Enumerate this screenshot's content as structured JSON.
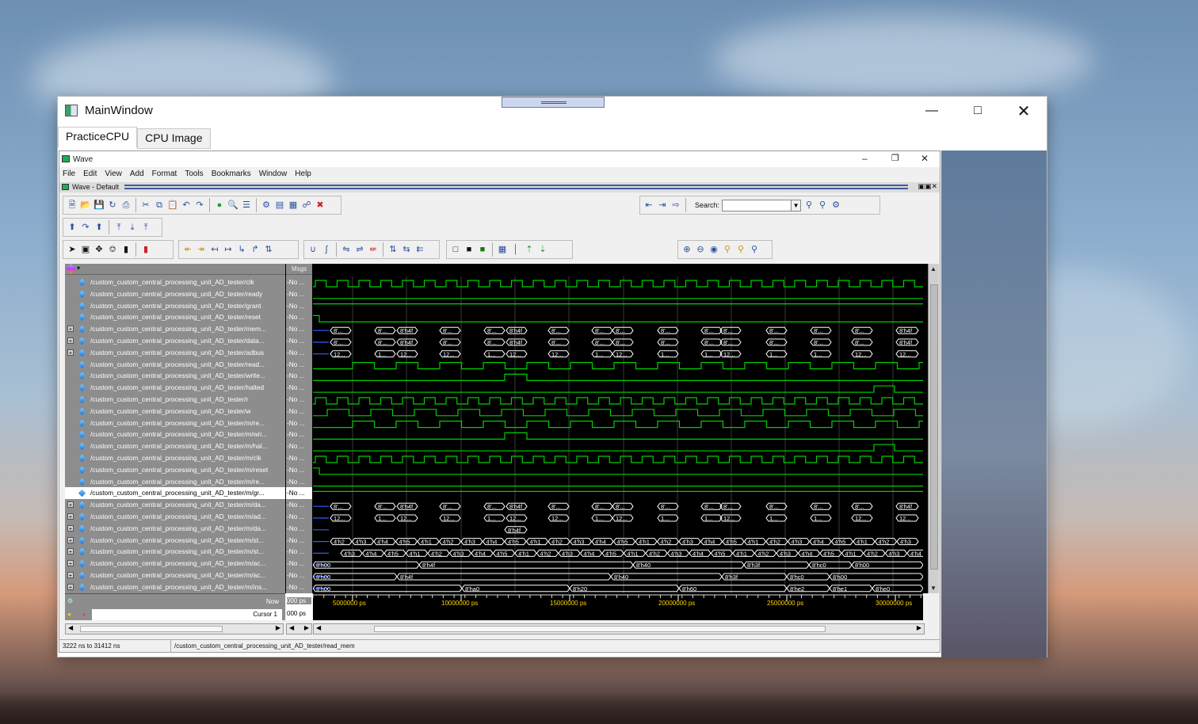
{
  "main_window": {
    "title": "MainWindow",
    "tabs": [
      "PracticeCPU",
      "CPU Image"
    ],
    "active_tab": 0
  },
  "wave_window": {
    "title": "Wave",
    "menu": [
      "File",
      "Edit",
      "View",
      "Add",
      "Format",
      "Tools",
      "Bookmarks",
      "Window",
      "Help"
    ],
    "doc_title": "Wave - Default",
    "search_label": "Search:",
    "msgs_header": "Msgs",
    "signals": [
      {
        "name": "/custom_custom_central_processing_unit_AD_tester/clk",
        "msg": "-No ...",
        "expandable": false
      },
      {
        "name": "/custom_custom_central_processing_unit_AD_tester/ready",
        "msg": "-No ...",
        "expandable": false
      },
      {
        "name": "/custom_custom_central_processing_unit_AD_tester/grant",
        "msg": "-No ...",
        "expandable": false
      },
      {
        "name": "/custom_custom_central_processing_unit_AD_tester/reset",
        "msg": "-No ...",
        "expandable": false
      },
      {
        "name": "/custom_custom_central_processing_unit_AD_tester/mem...",
        "msg": "-No ...",
        "expandable": true
      },
      {
        "name": "/custom_custom_central_processing_unit_AD_tester/data...",
        "msg": "-No ...",
        "expandable": true
      },
      {
        "name": "/custom_custom_central_processing_unit_AD_tester/adbus",
        "msg": "-No ...",
        "expandable": true
      },
      {
        "name": "/custom_custom_central_processing_unit_AD_tester/read...",
        "msg": "-No ...",
        "expandable": false
      },
      {
        "name": "/custom_custom_central_processing_unit_AD_tester/write...",
        "msg": "-No ...",
        "expandable": false
      },
      {
        "name": "/custom_custom_central_processing_unit_AD_tester/halted",
        "msg": "-No ...",
        "expandable": false
      },
      {
        "name": "/custom_custom_central_processing_unit_AD_tester/r",
        "msg": "-No ...",
        "expandable": false
      },
      {
        "name": "/custom_custom_central_processing_unit_AD_tester/w",
        "msg": "-No ...",
        "expandable": false
      },
      {
        "name": "/custom_custom_central_processing_unit_AD_tester/m/re...",
        "msg": "-No ...",
        "expandable": false
      },
      {
        "name": "/custom_custom_central_processing_unit_AD_tester/m/wri...",
        "msg": "-No ...",
        "expandable": false
      },
      {
        "name": "/custom_custom_central_processing_unit_AD_tester/m/hal...",
        "msg": "-No ...",
        "expandable": false
      },
      {
        "name": "/custom_custom_central_processing_unit_AD_tester/m/clk",
        "msg": "-No ...",
        "expandable": false
      },
      {
        "name": "/custom_custom_central_processing_unit_AD_tester/m/reset",
        "msg": "-No ...",
        "expandable": false
      },
      {
        "name": "/custom_custom_central_processing_unit_AD_tester/m/re...",
        "msg": "-No ...",
        "expandable": false
      },
      {
        "name": "/custom_custom_central_processing_unit_AD_tester/m/gr...",
        "msg": "-No ...",
        "expandable": false,
        "selected": true
      },
      {
        "name": "/custom_custom_central_processing_unit_AD_tester/m/da...",
        "msg": "-No ...",
        "expandable": true
      },
      {
        "name": "/custom_custom_central_processing_unit_AD_tester/m/ad...",
        "msg": "-No ...",
        "expandable": true
      },
      {
        "name": "/custom_custom_central_processing_unit_AD_tester/m/da...",
        "msg": "-No ...",
        "expandable": true
      },
      {
        "name": "/custom_custom_central_processing_unit_AD_tester/m/st...",
        "msg": "-No ...",
        "expandable": true
      },
      {
        "name": "/custom_custom_central_processing_unit_AD_tester/m/st...",
        "msg": "-No ...",
        "expandable": true
      },
      {
        "name": "/custom_custom_central_processing_unit_AD_tester/m/ac...",
        "msg": "-No ...",
        "expandable": true
      },
      {
        "name": "/custom_custom_central_processing_unit_AD_tester/m/ac...",
        "msg": "-No ...",
        "expandable": true
      },
      {
        "name": "/custom_custom_central_processing_unit_AD_tester/m/ins...",
        "msg": "-No ...",
        "expandable": true
      }
    ],
    "now_label": "Now",
    "now_value": "000 ps",
    "cursor_label": "Cursor 1",
    "cursor_value": "000 ps",
    "time_ticks": [
      "5000000 ps",
      "10000000 ps",
      "15000000 ps",
      "20000000 ps",
      "25000000 ps",
      "30000000 ps"
    ],
    "status_range": "3222 ns to 31412 ns",
    "status_path": "/custom_custom_central_processing_unit_AD_tester/read_mem",
    "bus_labels": {
      "acc1": [
        "8'h00",
        "8'h4f",
        "8'h40",
        "8'h3f",
        "8'hc0",
        "8'h00"
      ],
      "acc2": [
        "8'h00",
        "8'h4f",
        "8'h40",
        "8'h3f",
        "8'hc0",
        "8'h00"
      ],
      "ins": [
        "8'h00",
        "8'ha0",
        "8'h20",
        "8'h60",
        "8'he2",
        "8'he1",
        "8'he0"
      ],
      "state1": [
        "4'h2",
        "4'h3",
        "4'h4",
        "4'h5",
        "4'h1"
      ],
      "data_m": "8'h4f"
    },
    "colors": {
      "wave": "#00d000",
      "bus": "#ffffff",
      "highz": "#2f5cff",
      "background": "#000000"
    }
  }
}
